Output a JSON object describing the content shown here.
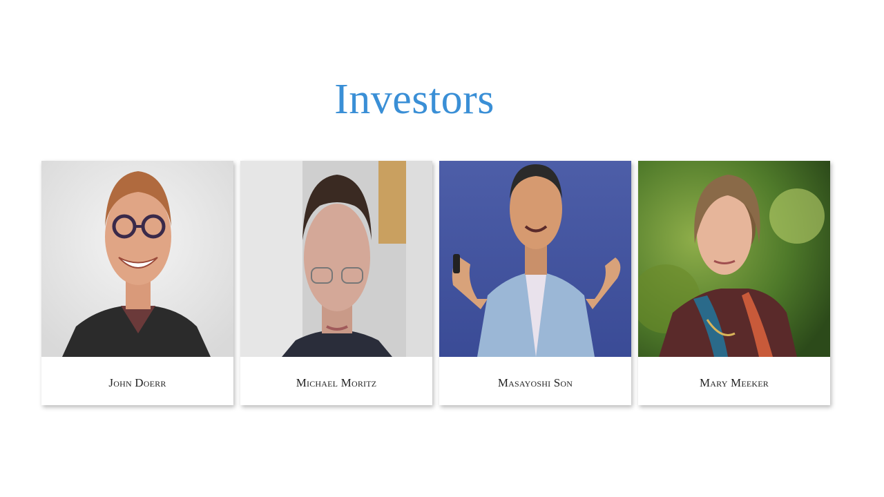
{
  "slide": {
    "title": "Investors",
    "title_color": "#3a8fd6"
  },
  "investors": [
    {
      "name": "John Doerr",
      "photo": "portrait-photo"
    },
    {
      "name": "Michael Moritz",
      "photo": "portrait-photo"
    },
    {
      "name": "Masayoshi Son",
      "photo": "portrait-photo"
    },
    {
      "name": "Mary Meeker",
      "photo": "portrait-photo"
    }
  ]
}
